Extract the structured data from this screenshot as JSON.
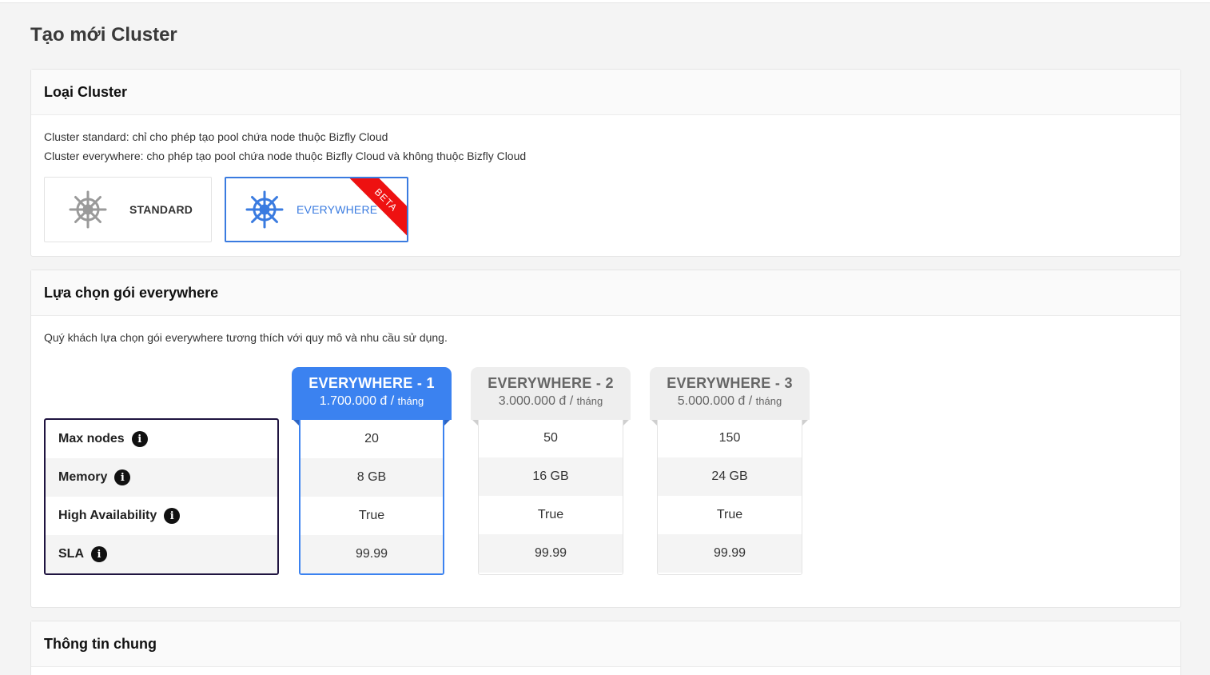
{
  "page_title": "Tạo mới Cluster",
  "cluster_type": {
    "header": "Loại Cluster",
    "desc_standard": "Cluster standard: chỉ cho phép tạo pool chứa node thuộc Bizfly Cloud",
    "desc_everywhere": "Cluster everywhere: cho phép tạo pool chứa node thuộc Bizfly Cloud và không thuộc Bizfly Cloud",
    "options": [
      {
        "label": "STANDARD",
        "icon": "ship-wheel-icon",
        "color": "#9a9a9a",
        "selected": false
      },
      {
        "label": "EVERYWHERE",
        "icon": "ship-wheel-icon",
        "color": "#3a7be0",
        "selected": true,
        "badge": "BETA"
      }
    ]
  },
  "plan_section": {
    "header": "Lựa chọn gói everywhere",
    "desc": "Quý khách lựa chọn gói everywhere tương thích với quy mô và nhu cầu sử dụng.",
    "spec_labels": [
      "Max nodes",
      "Memory",
      "High Availability",
      "SLA"
    ],
    "info_icon": "info-icon",
    "plans": [
      {
        "name": "EVERYWHERE - 1",
        "price": "1.700.000 đ /",
        "unit": "tháng",
        "selected": true,
        "values": [
          "20",
          "8 GB",
          "True",
          "99.99"
        ]
      },
      {
        "name": "EVERYWHERE - 2",
        "price": "3.000.000 đ /",
        "unit": "tháng",
        "selected": false,
        "values": [
          "50",
          "16 GB",
          "True",
          "99.99"
        ]
      },
      {
        "name": "EVERYWHERE - 3",
        "price": "5.000.000 đ /",
        "unit": "tháng",
        "selected": false,
        "values": [
          "150",
          "24 GB",
          "True",
          "99.99"
        ]
      }
    ]
  },
  "general_info": {
    "header": "Thông tin chung"
  },
  "colors": {
    "accent": "#3b82f0",
    "beta_ribbon": "#ee1111",
    "spec_border": "#1f1440"
  }
}
